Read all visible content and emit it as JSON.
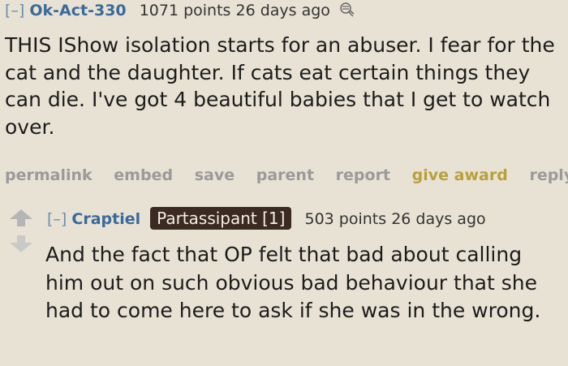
{
  "comment1": {
    "toggle": "[–]",
    "author": "Ok-Act-330",
    "score": "1071 points 26 days ago",
    "award_icon": "award-icon",
    "body": "THIS IShow isolation starts for an abuser. I fear for the cat and the daughter. If cats eat certain things they can die. I've got 4 beautiful babies that I get to watch over.",
    "actions": {
      "permalink": "permalink",
      "embed": "embed",
      "save": "save",
      "parent": "parent",
      "report": "report",
      "give_award": "give award",
      "reply": "reply"
    }
  },
  "comment2": {
    "toggle": "[–]",
    "author": "Craptiel",
    "flair": "Partassipant [1]",
    "score": "503 points 26 days ago",
    "body": "And the fact that OP felt that bad about calling him out on such obvious bad behaviour that she had to come here to ask if she was in the wrong."
  },
  "colors": {
    "background": "#e8e2d4",
    "author": "#3a6a9a",
    "upvote": "#b5b5b5",
    "downvote": "#c9c9c9",
    "give_award": "#b8a13a",
    "flair_bg": "#3b2a22"
  }
}
